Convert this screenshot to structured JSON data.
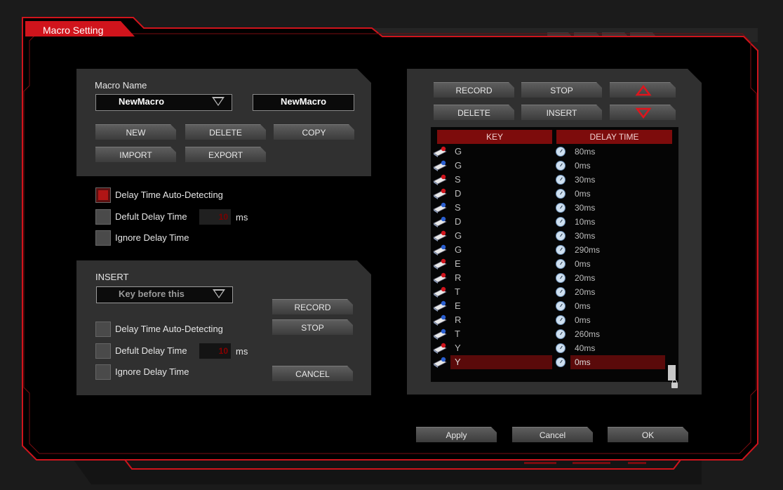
{
  "window": {
    "title": "Macro Setting"
  },
  "colors": {
    "accent": "#d0141c",
    "panel": "#303030",
    "selected_row": "#5a0a0a",
    "header_red": "#7d0c0c"
  },
  "macro": {
    "name_label": "Macro Name",
    "name_select": "NewMacro",
    "name_input": "NewMacro",
    "buttons": {
      "new": "NEW",
      "delete": "DELETE",
      "copy": "COPY",
      "import": "IMPORT",
      "export": "EXPORT"
    }
  },
  "options": {
    "auto_detect": {
      "label": "Delay Time Auto-Detecting",
      "checked": true
    },
    "default_delay": {
      "label": "Defult Delay Time",
      "value": "10",
      "unit": "ms",
      "checked": false
    },
    "ignore_delay": {
      "label": "Ignore Delay Time",
      "checked": false
    }
  },
  "insert": {
    "label": "INSERT",
    "select": "Key before this",
    "record": "RECORD",
    "stop": "STOP",
    "cancel": "CANCEL",
    "auto_detect": {
      "label": "Delay Time Auto-Detecting",
      "checked": false
    },
    "default_delay": {
      "label": "Defult Delay Time",
      "value": "10",
      "unit": "ms",
      "checked": false
    },
    "ignore_delay": {
      "label": "Ignore Delay Time",
      "checked": false
    }
  },
  "editor": {
    "record": "RECORD",
    "stop": "STOP",
    "delete": "DELETE",
    "insert": "INSERT",
    "up_icon": "triangle-up-icon",
    "down_icon": "triangle-down-icon",
    "columns": {
      "key": "KEY",
      "delay": "DELAY TIME"
    },
    "rows": [
      {
        "key": "G",
        "delay": "80ms",
        "action": "down"
      },
      {
        "key": "G",
        "delay": "0ms",
        "action": "up"
      },
      {
        "key": "S",
        "delay": "30ms",
        "action": "down"
      },
      {
        "key": "D",
        "delay": "0ms",
        "action": "down"
      },
      {
        "key": "S",
        "delay": "30ms",
        "action": "up"
      },
      {
        "key": "D",
        "delay": "10ms",
        "action": "up"
      },
      {
        "key": "G",
        "delay": "30ms",
        "action": "down"
      },
      {
        "key": "G",
        "delay": "290ms",
        "action": "up"
      },
      {
        "key": "E",
        "delay": "0ms",
        "action": "down"
      },
      {
        "key": "R",
        "delay": "20ms",
        "action": "down"
      },
      {
        "key": "T",
        "delay": "20ms",
        "action": "down"
      },
      {
        "key": "E",
        "delay": "0ms",
        "action": "up"
      },
      {
        "key": "R",
        "delay": "0ms",
        "action": "up"
      },
      {
        "key": "T",
        "delay": "260ms",
        "action": "up"
      },
      {
        "key": "Y",
        "delay": "40ms",
        "action": "down"
      },
      {
        "key": "Y",
        "delay": "0ms",
        "action": "up",
        "selected": true
      }
    ]
  },
  "footer": {
    "apply": "Apply",
    "cancel": "Cancel",
    "ok": "OK"
  }
}
